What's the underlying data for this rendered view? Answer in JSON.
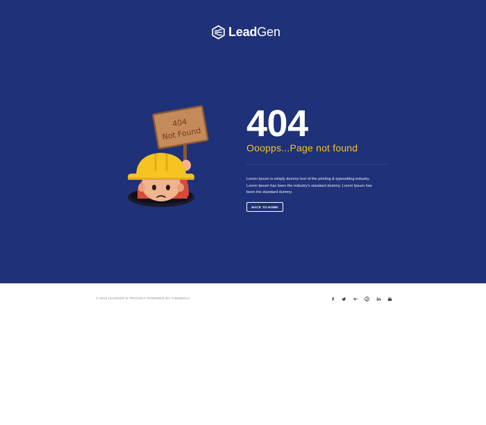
{
  "brand": {
    "name_bold": "Lead",
    "name_regular": "Gen",
    "logo_icon": "hexagon-logo-icon"
  },
  "illustration": {
    "sign_line1": "404",
    "sign_line2": "Not Found",
    "icon": "construction-worker-sign-illustration"
  },
  "error": {
    "code": "404",
    "title": "Ooopps...Page not found",
    "description": "Lorem Ipsum is simply dummy text of the printing & typesetting industry. Lorem Ipsum has been the industry's standard dummy. Lorem Ipsum has been the standard dummy.",
    "button_label": "BACK TO HOME"
  },
  "footer": {
    "copyright": "© 2016 LEADGEN IS PROUDLY POWERED BY THEMEZAA",
    "social": [
      {
        "name": "facebook-icon",
        "glyph": "f"
      },
      {
        "name": "twitter-icon",
        "glyph": "t"
      },
      {
        "name": "google-plus-icon",
        "glyph": "G+"
      },
      {
        "name": "pinterest-icon",
        "glyph": "p"
      },
      {
        "name": "linkedin-icon",
        "glyph": "in"
      },
      {
        "name": "youtube-icon",
        "glyph": "yt"
      }
    ]
  },
  "colors": {
    "hero_bg": "#1f3178",
    "accent_yellow": "#f5c423",
    "footer_bg": "#ffffff"
  }
}
